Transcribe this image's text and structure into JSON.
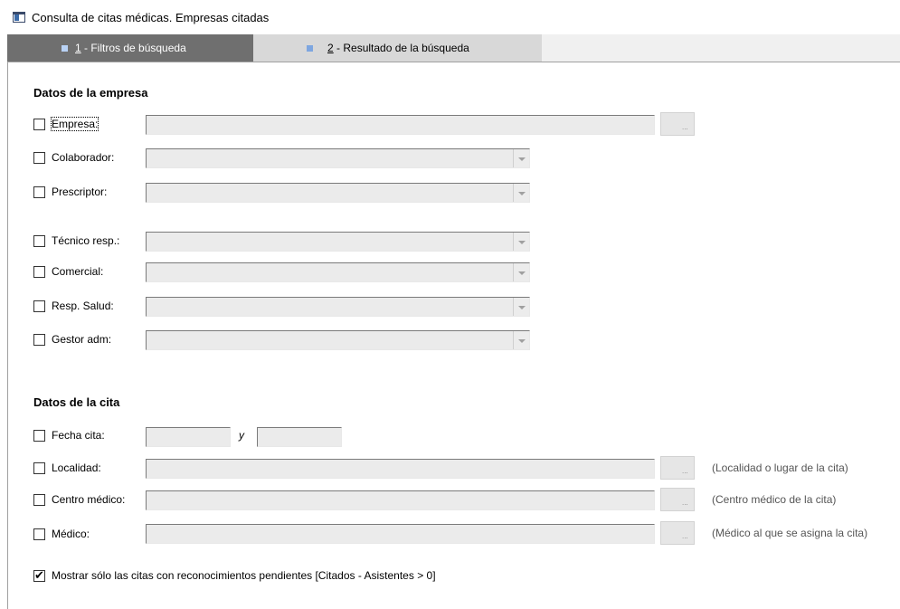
{
  "window": {
    "title": "Consulta de citas médicas. Empresas citadas"
  },
  "tabs": [
    {
      "number": "1",
      "label": " - Filtros de búsqueda"
    },
    {
      "number": "2",
      "label": " - Resultado de la búsqueda"
    }
  ],
  "empresa_section": {
    "title": "Datos de la empresa",
    "fields": [
      {
        "label": "Empresa:",
        "value": ""
      },
      {
        "label": "Colaborador:",
        "value": ""
      },
      {
        "label": "Prescriptor:",
        "value": ""
      },
      {
        "label": "Técnico resp.:",
        "value": ""
      },
      {
        "label": "Comercial:",
        "value": ""
      },
      {
        "label": "Resp. Salud:",
        "value": ""
      },
      {
        "label": "Gestor adm:",
        "value": ""
      }
    ]
  },
  "cita_section": {
    "title": "Datos de la cita",
    "fecha": {
      "label": "Fecha cita:",
      "from": "",
      "to": "",
      "separator": "y"
    },
    "localidad": {
      "label": "Localidad:",
      "value": "",
      "hint": "(Localidad o lugar de la cita)"
    },
    "centro": {
      "label": "Centro médico:",
      "value": "",
      "hint": "(Centro médico de la cita)"
    },
    "medico": {
      "label": "Médico:",
      "value": "",
      "hint": "(Médico al que se asigna la cita)"
    },
    "pendientes": {
      "label": "Mostrar sólo las citas con reconocimientos pendientes [Citados - Asistentes > 0]",
      "checked": true
    }
  },
  "buttons": {
    "ellipsis": "..."
  }
}
